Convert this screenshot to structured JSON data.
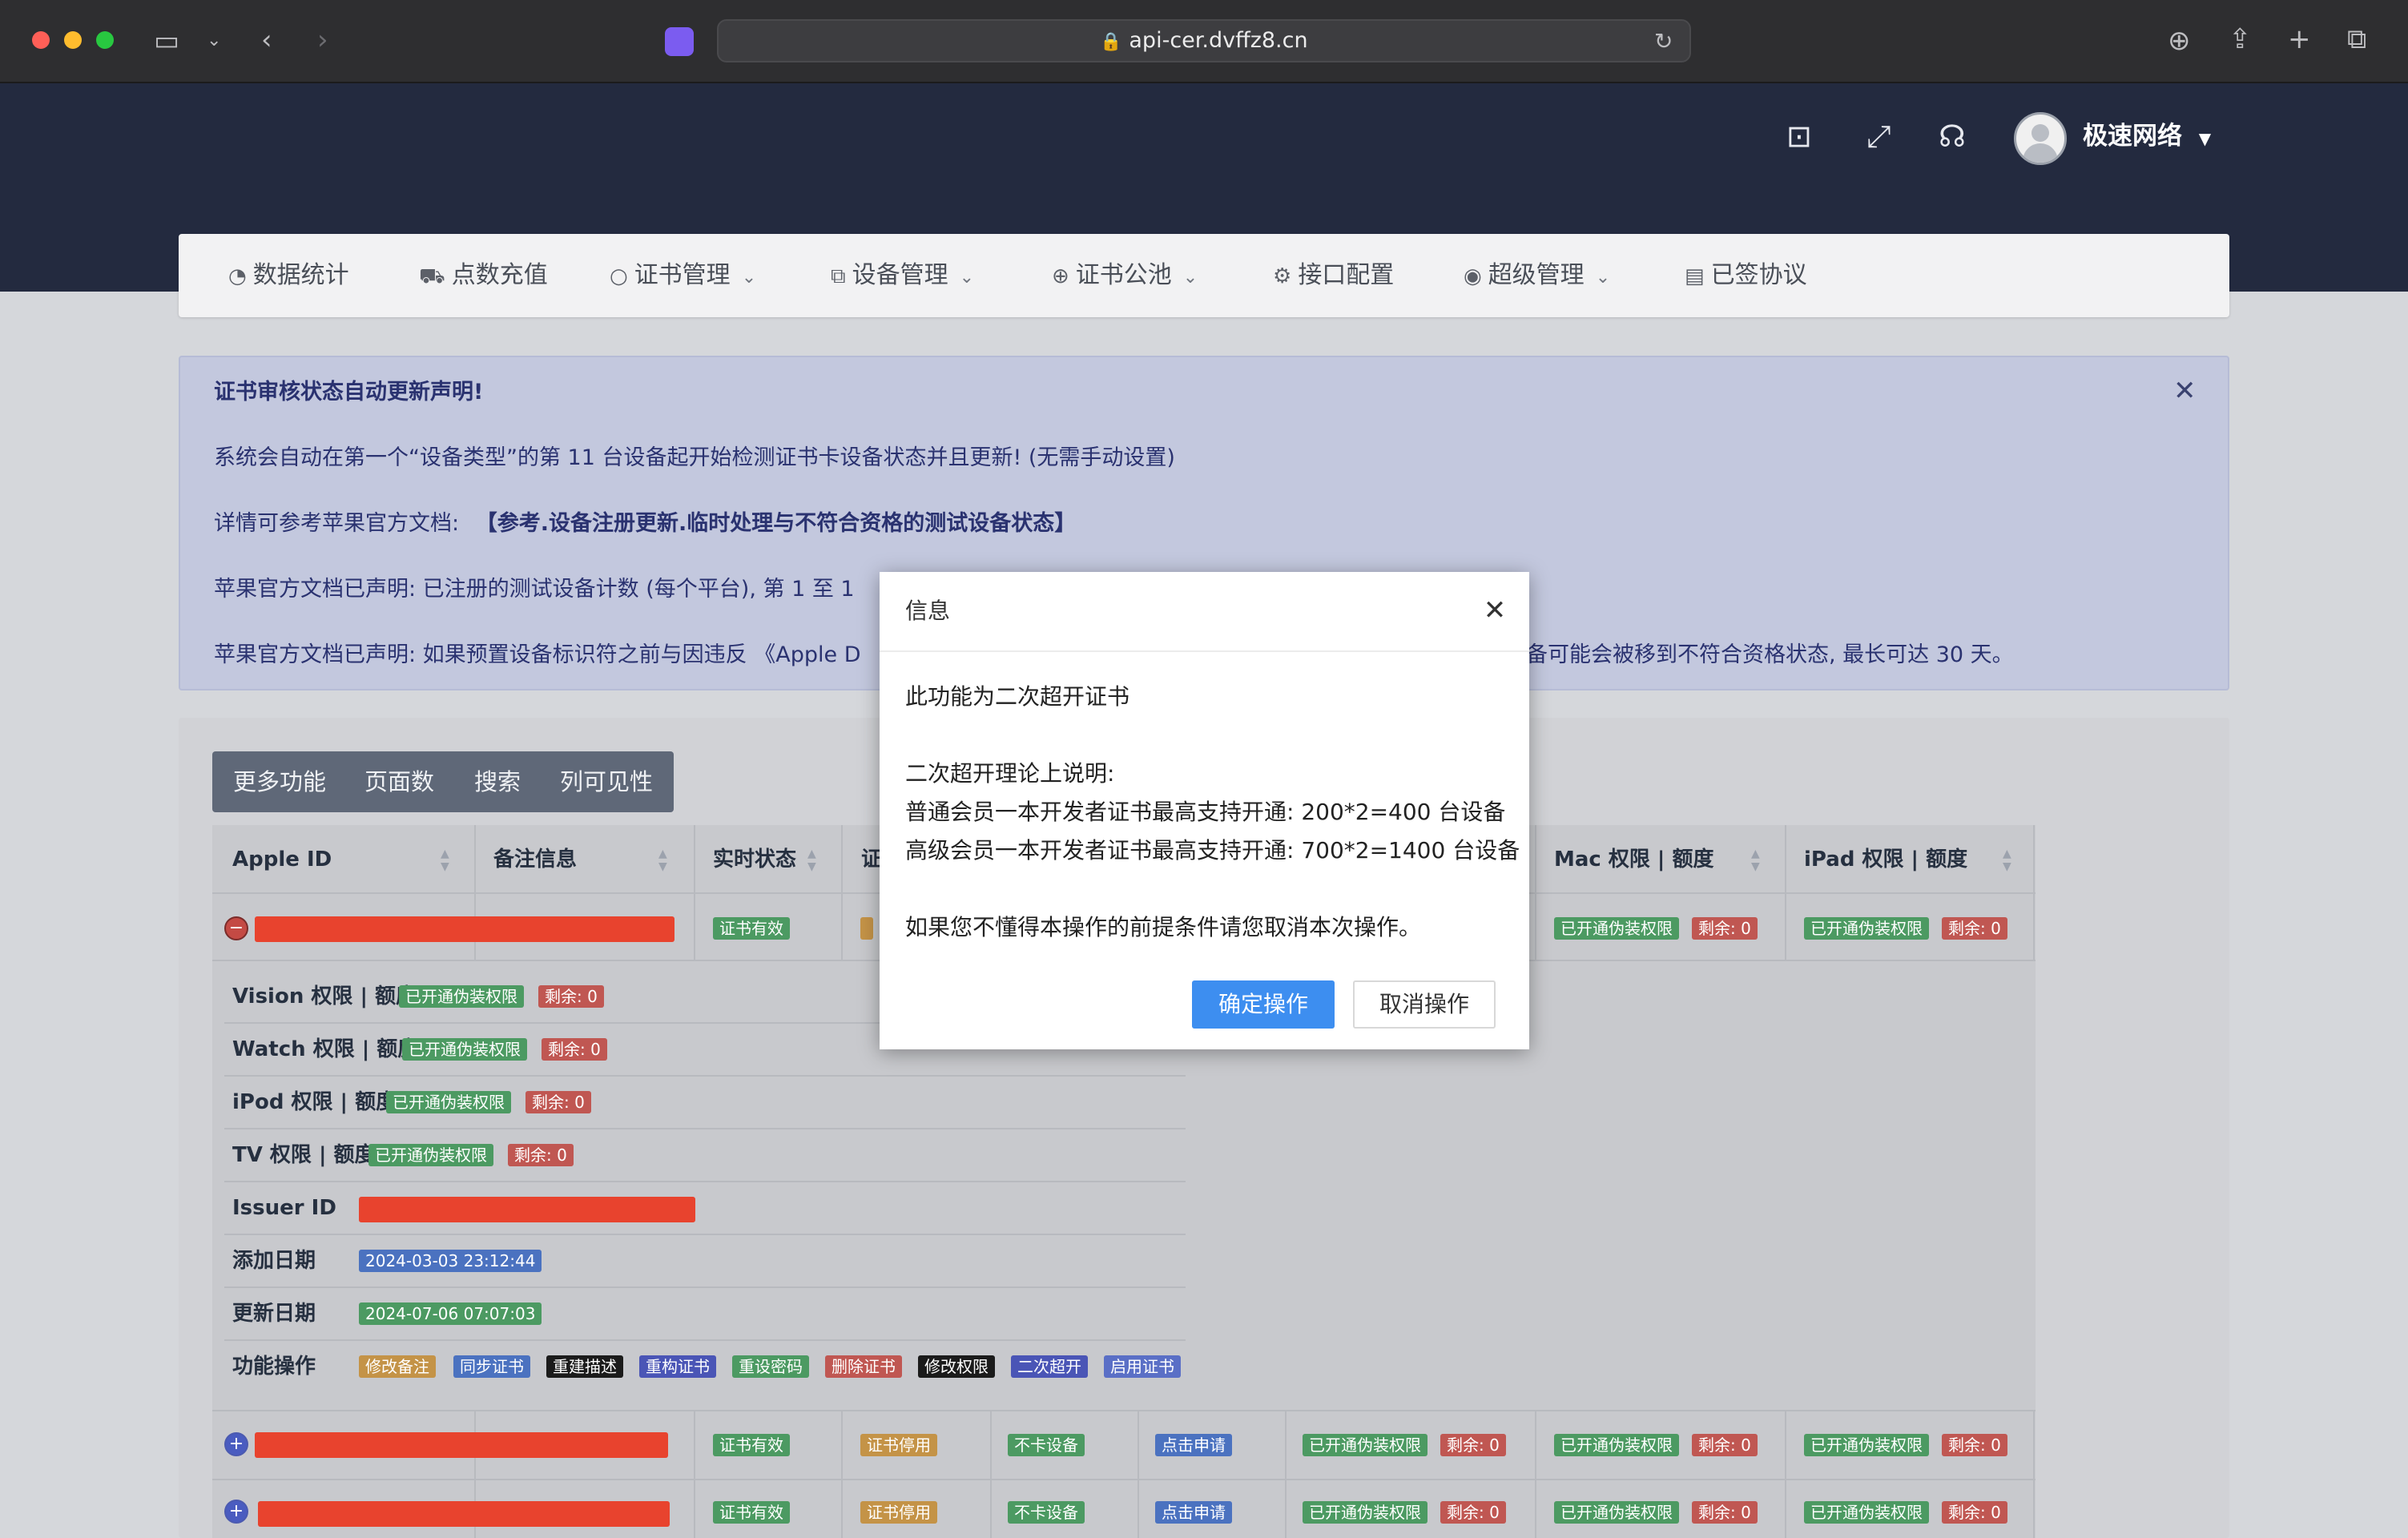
{
  "browser": {
    "url": "api-cer.dvffz8.cn"
  },
  "header": {
    "user_name": "极速网络"
  },
  "nav": {
    "items": [
      {
        "label": "数据统计",
        "icon": "clock-icon"
      },
      {
        "label": "点数充值",
        "icon": "cart-icon"
      },
      {
        "label": "证书管理",
        "icon": "circle-icon",
        "dropdown": true
      },
      {
        "label": "设备管理",
        "icon": "copy-icon",
        "dropdown": true
      },
      {
        "label": "证书公池",
        "icon": "plus-circle-icon",
        "dropdown": true
      },
      {
        "label": "接口配置",
        "icon": "gear-icon"
      },
      {
        "label": "超级管理",
        "icon": "user-circle-icon",
        "dropdown": true
      },
      {
        "label": "已签协议",
        "icon": "document-icon"
      }
    ]
  },
  "notice": {
    "title": "证书审核状态自动更新声明!",
    "line1": "系统会自动在第一个“设备类型”的第 11 台设备起开始检测证书卡设备状态并且更新! (无需手动设置)",
    "line2_prefix": "详情可参考苹果官方文档:",
    "line2_link": "【参考.设备注册更新.临时处理与不符合资格的测试设备状态】",
    "line3": "苹果官方文档已声明: 已注册的测试设备计数 (每个平台), 第 1 至 1",
    "line4_left": "苹果官方文档已声明: 如果预置设备标识符之前与因违反 《Apple D",
    "line4_right": "备可能会被移到不符合资格状态, 最长可达 30 天。"
  },
  "toolbar": {
    "buttons": [
      "更多功能",
      "页面数",
      "搜索",
      "列可见性"
    ]
  },
  "table": {
    "headers": {
      "apple_id": "Apple ID",
      "note": "备注信息",
      "status": "实时状态",
      "cert_partial": "证",
      "mac": "Mac 权限 | 额度",
      "ipad": "iPad 权限 | 额度"
    },
    "row_badges": {
      "cert_valid": "证书有效",
      "cert_stopped": "证书停用",
      "no_device": "不卡设备",
      "click_apply": "点击申请",
      "perm_on": "已开通伪装权限",
      "remain": "剩余: 0"
    },
    "details": {
      "vision": "Vision 权限 | 额度",
      "watch": "Watch 权限 | 额度",
      "ipod": "iPod 权限 | 额度",
      "tv": "TV 权限 | 额度",
      "issuer": "Issuer ID",
      "added": "添加日期",
      "added_value": "2024-03-03 23:12:44",
      "updated": "更新日期",
      "updated_value": "2024-07-06 07:07:03",
      "actions_label": "功能操作",
      "actions": [
        "修改备注",
        "同步证书",
        "重建描述",
        "重构证书",
        "重设密码",
        "删除证书",
        "修改权限",
        "二次超开",
        "启用证书"
      ]
    }
  },
  "modal": {
    "title": "信息",
    "line1": "此功能为二次超开证书",
    "line2": "二次超开理论上说明:",
    "line3": "普通会员一本开发者证书最高支持开通: 200*2=400 台设备",
    "line4": "高级会员一本开发者证书最高支持开通: 700*2=1400 台设备",
    "line5": "如果您不懂得本操作的前提条件请您取消本次操作。",
    "confirm": "确定操作",
    "cancel": "取消操作"
  }
}
